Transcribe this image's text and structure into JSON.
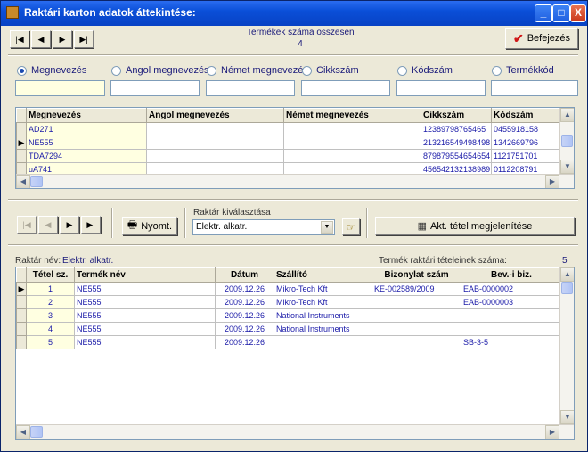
{
  "window": {
    "title": "Raktári karton adatok áttekintése:",
    "min_label": "_",
    "max_label": "□",
    "close_label": "X"
  },
  "nav": {
    "first": "|◀",
    "prev": "◀",
    "next": "▶",
    "last": "▶|"
  },
  "summary": {
    "label": "Termékek száma összesen",
    "count": "4"
  },
  "finish_button": {
    "icon": "✔",
    "label": "Befejezés"
  },
  "search": {
    "radios": [
      {
        "label": "Megnevezés",
        "checked": true
      },
      {
        "label": "Angol megnevezés",
        "checked": false
      },
      {
        "label": "Német megnevezés",
        "checked": false
      },
      {
        "label": "Cikkszám",
        "checked": false
      },
      {
        "label": "Kódszám",
        "checked": false
      },
      {
        "label": "Termékkód",
        "checked": false
      }
    ],
    "values": [
      "",
      "",
      "",
      "",
      "",
      ""
    ]
  },
  "products": {
    "columns": [
      "Megnevezés",
      "Angol megnevezés",
      "Német megnevezés",
      "Cikkszám",
      "Kódszám"
    ],
    "rows": [
      {
        "indicator": "",
        "cells": [
          "AD271",
          "",
          "",
          "12389798765465",
          "0455918158"
        ]
      },
      {
        "indicator": "▶",
        "cells": [
          "NE555",
          "",
          "",
          "213216549498498",
          "1342669796"
        ]
      },
      {
        "indicator": "",
        "cells": [
          "TDA7294",
          "",
          "",
          "879879554654654",
          "1121751701"
        ]
      },
      {
        "indicator": "",
        "cells": [
          "uA741",
          "",
          "",
          "456542132138989",
          "0112208791"
        ]
      }
    ]
  },
  "middle": {
    "print_label": "Nyomt.",
    "warehouse_select_label": "Raktár kiválasztása",
    "warehouse_selected": "Elektr. alkatr.",
    "show_item_label": "Akt. tétel megjelenítése"
  },
  "stock": {
    "warehouse_name_label": "Raktár név:",
    "warehouse_name_value": "Elektr. alkatr.",
    "count_label": "Termék raktári tételeinek száma:",
    "count_value": "5",
    "columns": [
      "Tétel sz.",
      "Termék név",
      "Dátum",
      "Szállító",
      "Bizonylat szám",
      "Bev.-i biz."
    ],
    "rows": [
      {
        "indicator": "▶",
        "cells": [
          "1",
          "NE555",
          "2009.12.26",
          "Mikro-Tech Kft",
          "KE-002589/2009",
          "EAB-0000002"
        ]
      },
      {
        "indicator": "",
        "cells": [
          "2",
          "NE555",
          "2009.12.26",
          "Mikro-Tech Kft",
          "",
          "EAB-0000003"
        ]
      },
      {
        "indicator": "",
        "cells": [
          "3",
          "NE555",
          "2009.12.26",
          "National Instruments",
          "",
          ""
        ]
      },
      {
        "indicator": "",
        "cells": [
          "4",
          "NE555",
          "2009.12.26",
          "National Instruments",
          "",
          ""
        ]
      },
      {
        "indicator": "",
        "cells": [
          "5",
          "NE555",
          "2009.12.26",
          "",
          "",
          "SB-3-5"
        ]
      }
    ]
  }
}
